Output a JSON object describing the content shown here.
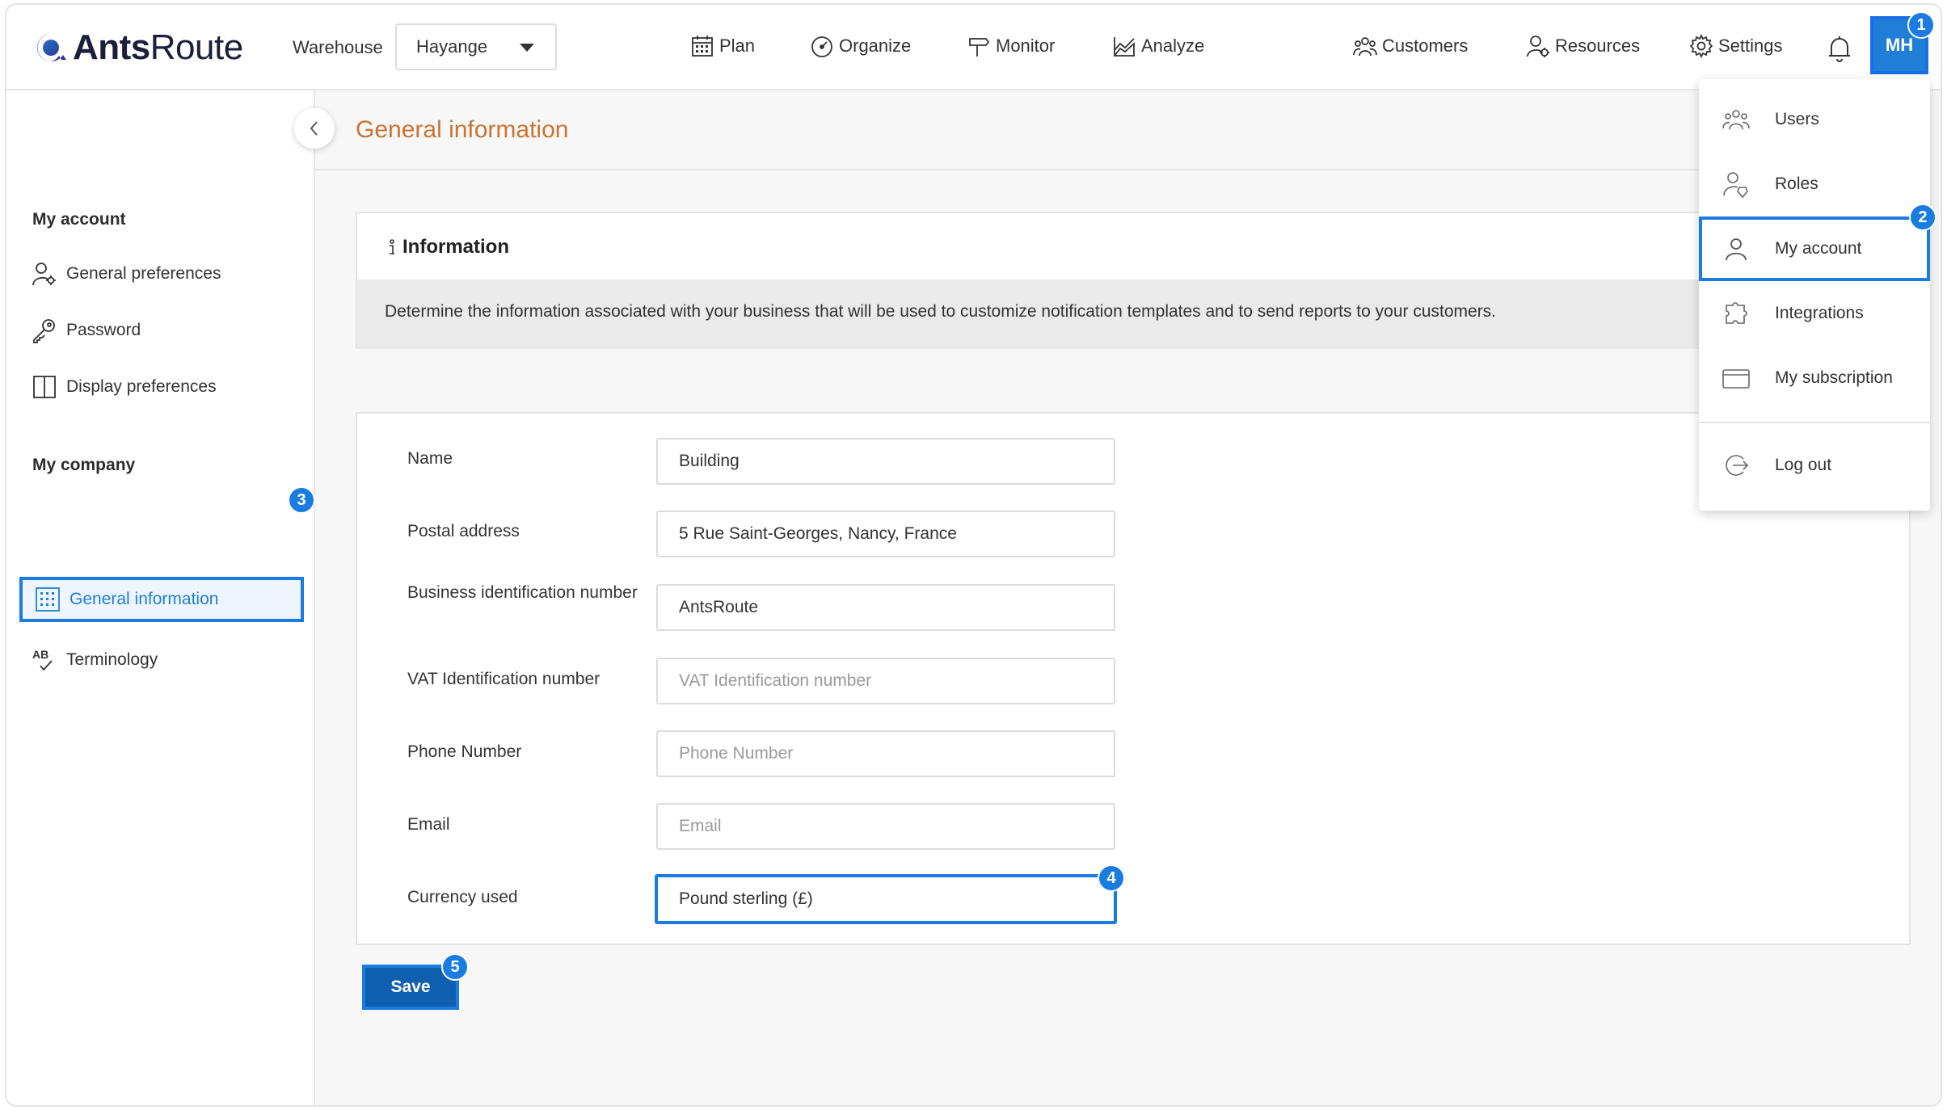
{
  "brand": {
    "name_a": "Ants",
    "name_b": "Route"
  },
  "header": {
    "warehouse_label": "Warehouse",
    "warehouse_value": "Hayange",
    "nav": {
      "plan": "Plan",
      "organize": "Organize",
      "monitor": "Monitor",
      "analyze": "Analyze",
      "customers": "Customers",
      "resources": "Resources",
      "settings": "Settings"
    },
    "avatar_initials": "MH"
  },
  "sidebar": {
    "section1": "My account",
    "items1": [
      "General preferences",
      "Password",
      "Display preferences"
    ],
    "section2": "My company",
    "items2": [
      "General information",
      "Terminology"
    ]
  },
  "page": {
    "title": "General information"
  },
  "info": {
    "heading": "Information",
    "description": "Determine the information associated with your business that will be used to customize notification templates and to send reports to your customers."
  },
  "form": {
    "name_label": "Name",
    "name_value": "Building",
    "address_label": "Postal address",
    "address_value": "5 Rue Saint-Georges, Nancy, France",
    "bin_label": "Business identification number",
    "bin_value": "AntsRoute",
    "vat_label": "VAT Identification number",
    "vat_placeholder": "VAT Identification number",
    "phone_label": "Phone Number",
    "phone_placeholder": "Phone Number",
    "email_label": "Email",
    "email_placeholder": "Email",
    "currency_label": "Currency used",
    "currency_value": "Pound sterling (£)",
    "save_label": "Save"
  },
  "dropdown": {
    "items": [
      "Users",
      "Roles",
      "My account",
      "Integrations",
      "My subscription",
      "Log out"
    ]
  },
  "badges": [
    "1",
    "2",
    "3",
    "4",
    "5"
  ],
  "colors": {
    "accent": "#1a7be0",
    "title": "#c87533",
    "save": "#0f5fb0"
  }
}
